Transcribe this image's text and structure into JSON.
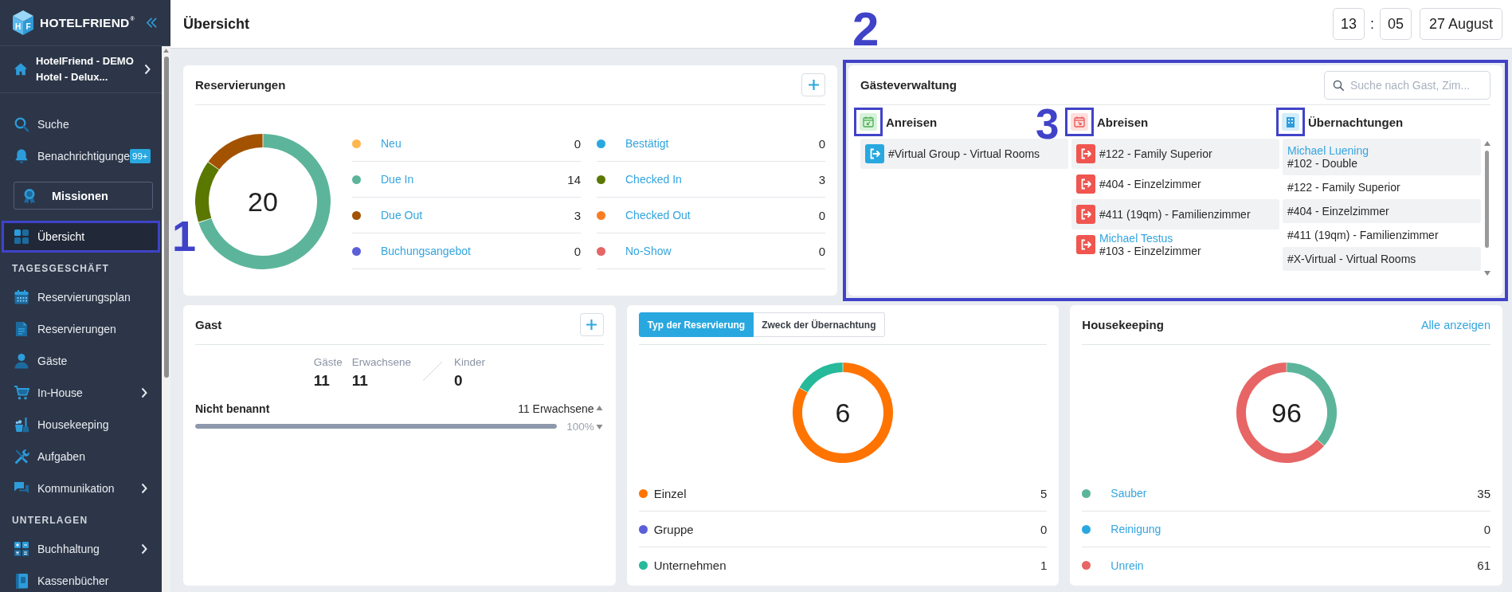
{
  "sidebar": {
    "logo": {
      "letters": [
        "H",
        "F"
      ],
      "wordmark": "HOTELFRIEND$^{®}$"
    },
    "hotel": "HotelFriend - DEMO Hotel - Delux...",
    "nav": [
      {
        "kind": "link",
        "label": "Suche",
        "selected": false,
        "marked": false,
        "expandable": false
      },
      {
        "kind": "link",
        "label": "Benachrichtigunge",
        "badge": "99+",
        "selected": false,
        "marked": false,
        "expandable": false
      },
      {
        "kind": "button",
        "label": "Missionen"
      },
      {
        "kind": "link",
        "label": "Übersicht",
        "selected": true,
        "marked": true,
        "callout": "1",
        "expandable": false
      },
      {
        "kind": "section",
        "label": "TAGESGESCHÄFT"
      },
      {
        "kind": "link",
        "label": "Reservierungsplan",
        "selected": false,
        "marked": false,
        "expandable": false
      },
      {
        "kind": "link",
        "label": "Reservierungen",
        "selected": false,
        "marked": false,
        "expandable": false
      },
      {
        "kind": "link",
        "label": "Gäste",
        "selected": false,
        "marked": false,
        "expandable": false
      },
      {
        "kind": "link",
        "label": "In-House",
        "selected": false,
        "marked": false,
        "expandable": true
      },
      {
        "kind": "link",
        "label": "Housekeeping",
        "selected": false,
        "marked": false,
        "expandable": false
      },
      {
        "kind": "link",
        "label": "Aufgaben",
        "selected": false,
        "marked": false,
        "expandable": false
      },
      {
        "kind": "link",
        "label": "Kommunikation",
        "selected": false,
        "marked": false,
        "expandable": true
      },
      {
        "kind": "section",
        "label": "UNTERLAGEN"
      },
      {
        "kind": "link",
        "label": "Buchhaltung",
        "selected": false,
        "marked": false,
        "expandable": true
      },
      {
        "kind": "link",
        "label": "Kassenbücher",
        "selected": false,
        "marked": false,
        "expandable": false
      }
    ]
  },
  "header": {
    "title": "Übersicht",
    "time": {
      "hours": "13",
      "separator": ":",
      "minutes": "05"
    },
    "date": "27 August"
  },
  "reservations": {
    "title": "Reservierungen",
    "total": "20",
    "chart_data": {
      "type": "donut",
      "categories": [
        "Neu",
        "Bestätigt",
        "Due In",
        "Checked In",
        "Due Out",
        "Checked Out",
        "Buchungsangebot",
        "No-Show"
      ],
      "values": [
        0,
        0,
        70,
        15,
        15,
        0,
        0,
        0
      ]
    },
    "legend": [
      {
        "count": "0",
        "color": "#ffb64d",
        "link": true
      },
      {
        "count": "0",
        "color": "#29a8e0",
        "link": true
      },
      {
        "count": "14",
        "color": "#5cb59a",
        "link": true
      },
      {
        "count": "3",
        "color": "#5a7800",
        "link": true
      },
      {
        "count": "3",
        "color": "#a35200",
        "link": true
      },
      {
        "count": "0",
        "color": "#fb7d23",
        "link": true
      },
      {
        "count": "0",
        "color": "#5b5fd9",
        "link": true
      },
      {
        "count": "0",
        "color": "#e66565",
        "link": true
      }
    ]
  },
  "guest_management": {
    "title": "Gästeverwaltung",
    "marked": true,
    "callout": "2",
    "search": {
      "placeholder": "Suche nach Gast, Zim..."
    },
    "columns": [
      {
        "kind": "arrivals",
        "title": "Anreisen",
        "marked": true,
        "rows": [
          {
            "room": "#Virtual Group - Virtual Rooms"
          }
        ]
      },
      {
        "kind": "departures",
        "title": "Abreisen",
        "marked": true,
        "callout": "3",
        "rows": [
          {
            "room": "#122 - Family Superior"
          },
          {
            "room": "#404 - Einzelzimmer"
          },
          {
            "room": "#411 (19qm) - Familienzimmer"
          },
          {
            "guest": "Michael Testus",
            "room": "#103 - Einzelzimmer"
          }
        ]
      },
      {
        "kind": "stays",
        "title": "Übernachtungen",
        "marked": true,
        "rows": [
          {
            "guest": "Michael Luening",
            "room": "#102 - Double"
          },
          {
            "room": "#122 - Family Superior"
          },
          {
            "room": "#404 - Einzelzimmer"
          },
          {
            "room": "#411 (19qm) - Familienzimmer"
          },
          {
            "room": "#X-Virtual - Virtual Rooms"
          }
        ]
      }
    ]
  },
  "guests": {
    "title": "Gast",
    "stats": [
      {
        "label": "Gäste",
        "value": "11"
      },
      {
        "label": "Erwachsene",
        "value": "11"
      },
      {
        "label": "Kinder",
        "value": "0"
      }
    ],
    "groups": [
      {
        "name": "Nicht benannt",
        "summary": "11 Erwachsene",
        "level": 1,
        "percent": "100%"
      }
    ]
  },
  "reservation_types": {
    "tabs": [
      {
        "label": "Typ der Reservierung",
        "selected": true
      },
      {
        "label": "Zweck der Übernachtung",
        "selected": false
      }
    ],
    "total": "6",
    "chart_data": {
      "type": "donut",
      "categories": [
        "Einzel",
        "Gruppe",
        "Unternehmen"
      ],
      "values": [
        83.33,
        0,
        16.67
      ]
    },
    "legend": [
      {
        "count": "5",
        "color": "#ff7300",
        "link": false
      },
      {
        "count": "0",
        "color": "#5b5fd9",
        "link": false
      },
      {
        "count": "1",
        "color": "#26b99a",
        "link": false
      }
    ]
  },
  "housekeeping": {
    "title": "Housekeeping",
    "link": "Alle anzeigen",
    "total": "96",
    "chart_data": {
      "type": "donut",
      "categories": [
        "Sauber",
        "Reinigung",
        "Unrein"
      ],
      "values": [
        36.46,
        0,
        63.54
      ]
    },
    "legend": [
      {
        "count": "35",
        "color": "#5cb59a",
        "link": true
      },
      {
        "count": "0",
        "color": "#29a8e0",
        "link": true
      },
      {
        "count": "61",
        "color": "#e86565",
        "link": true
      }
    ]
  }
}
